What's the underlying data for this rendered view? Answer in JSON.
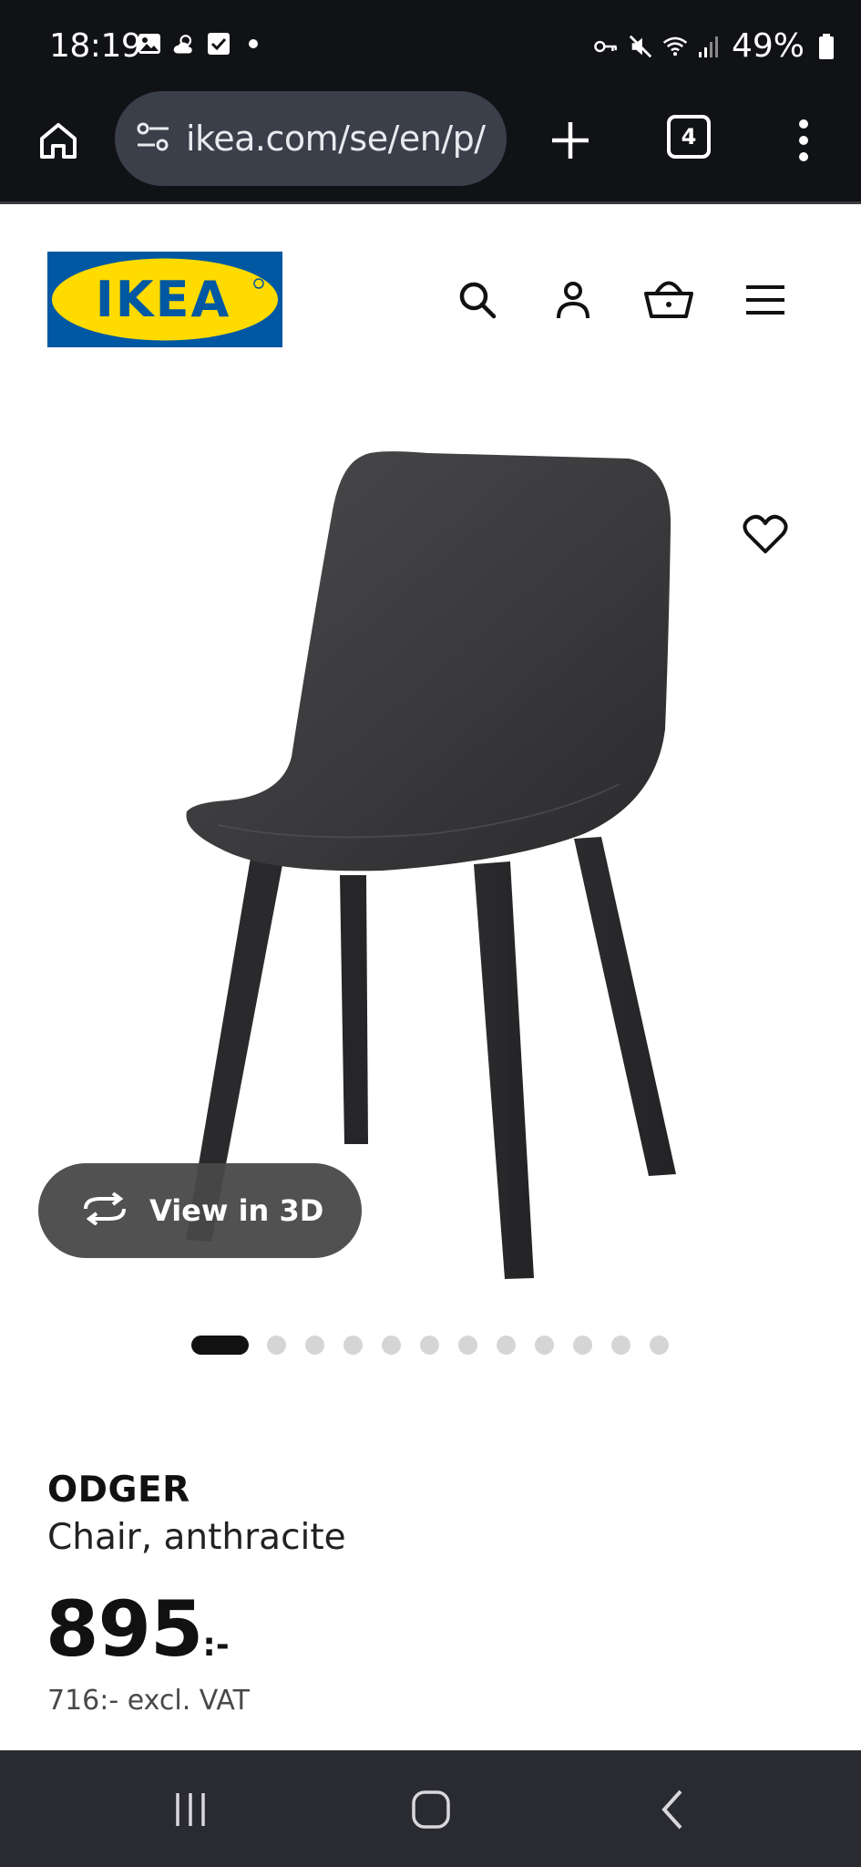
{
  "status_bar": {
    "time": "18:19",
    "battery": "49%",
    "left_icons": [
      "gallery-icon",
      "weather-icon",
      "checkbox-icon",
      "dot-icon"
    ],
    "right_icons": [
      "key-icon",
      "mute-icon",
      "wifi-icon",
      "signal-icon",
      "battery-icon"
    ]
  },
  "browser": {
    "url": "ikea.com/se/en/p/",
    "tab_count": "4",
    "icons": [
      "home-icon",
      "site-settings-icon",
      "new-tab-icon",
      "more-icon"
    ]
  },
  "header": {
    "logo_text": "IKEA",
    "icons": [
      "search-icon",
      "account-icon",
      "basket-icon",
      "menu-icon"
    ],
    "colors": {
      "logo_blue": "#0058a3",
      "logo_yellow": "#ffdb00"
    }
  },
  "product": {
    "name": "ODGER",
    "description": "Chair, anthracite",
    "price": "895",
    "price_suffix": ":-",
    "price_excl_vat": "716:- excl. VAT",
    "view_3d_label": "View in 3D",
    "gallery_total": 12,
    "gallery_active": 1
  },
  "nav_bar": {
    "icons": [
      "recents-icon",
      "home-icon",
      "back-icon"
    ]
  }
}
